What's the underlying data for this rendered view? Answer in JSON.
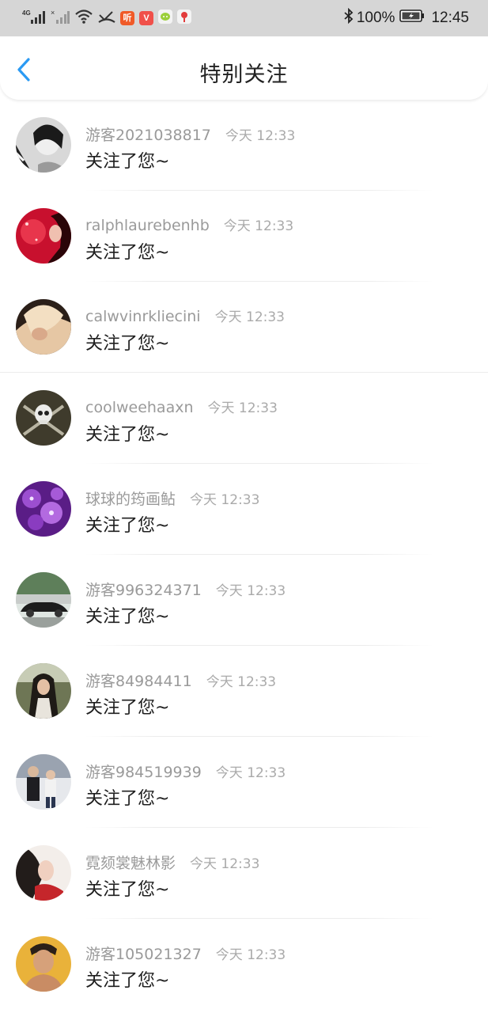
{
  "status_bar": {
    "network_label": "4G",
    "battery_percent": "100%",
    "time": "12:45",
    "app_badges": [
      {
        "icon": "ting-app-icon",
        "text": "听",
        "color": "#f05a28"
      },
      {
        "icon": "v-app-icon",
        "text": "V",
        "color": "#f0504a"
      }
    ]
  },
  "header": {
    "title": "特别关注",
    "accent_color": "#2b9af3"
  },
  "follows": [
    {
      "name": "游客2021038817",
      "time": "今天 12:33",
      "message": "关注了您~",
      "avatar_color": "#8a8a8a"
    },
    {
      "name": "ralphlaurebenhb",
      "time": "今天 12:33",
      "message": "关注了您~",
      "avatar_color": "#c8102e"
    },
    {
      "name": "calwvinrkliecini",
      "time": "今天 12:33",
      "message": "关注了您~",
      "avatar_color": "#caa384"
    },
    {
      "name": "coolweehaaxn",
      "time": "今天 12:33",
      "message": "关注了您~",
      "avatar_color": "#4a4636"
    },
    {
      "name": "球球的筠画鲇",
      "time": "今天 12:33",
      "message": "关注了您~",
      "avatar_color": "#7b2fa8"
    },
    {
      "name": "游客996324371",
      "time": "今天 12:33",
      "message": "关注了您~",
      "avatar_color": "#6f8f72"
    },
    {
      "name": "游客84984411",
      "time": "今天 12:33",
      "message": "关注了您~",
      "avatar_color": "#6a6f52"
    },
    {
      "name": "游客984519939",
      "time": "今天 12:33",
      "message": "关注了您~",
      "avatar_color": "#8f96a3"
    },
    {
      "name": "霓颏裳魅林影",
      "time": "今天 12:33",
      "message": "关注了您~",
      "avatar_color": "#b9423d"
    },
    {
      "name": "游客105021327",
      "time": "今天 12:33",
      "message": "关注了您~",
      "avatar_color": "#d9a53a"
    }
  ]
}
